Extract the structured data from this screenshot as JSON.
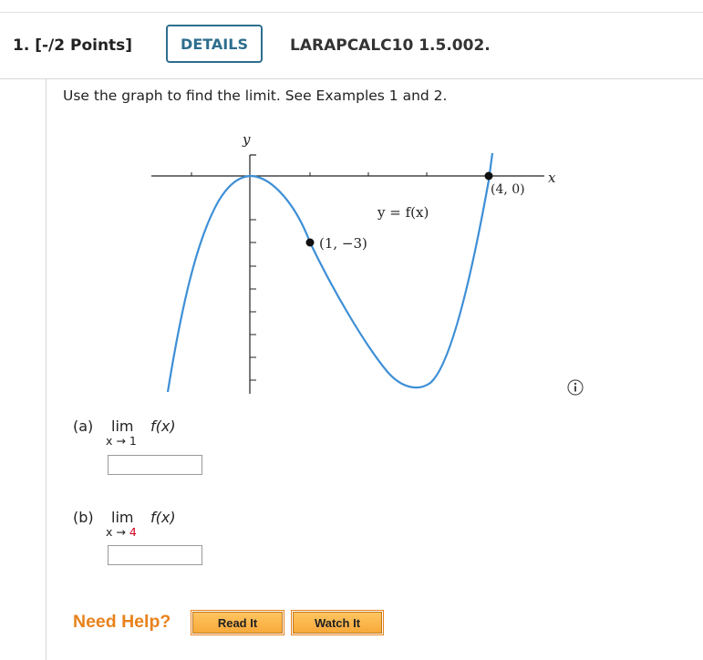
{
  "header": {
    "question_number": "1.  [-/2 Points]",
    "details_label": "DETAILS",
    "question_id": "LARAPCALC10 1.5.002."
  },
  "prompt": "Use the graph to find the limit. See Examples 1 and 2.",
  "graph": {
    "y_axis_label": "y",
    "x_axis_label": "x",
    "curve_label": "y = f(x)",
    "point_a_label": "(1, −3)",
    "point_b_label": "(4, 0)",
    "curve_color": "#3d8fd6"
  },
  "info_icon": "info-icon",
  "parts": [
    {
      "label": "(a)",
      "lim": "lim",
      "fx": "f(x)",
      "sub_prefix": "x → ",
      "sub_value": "1",
      "sub_value_red": false,
      "answer": ""
    },
    {
      "label": "(b)",
      "lim": "lim",
      "fx": "f(x)",
      "sub_prefix": "x → ",
      "sub_value": "4",
      "sub_value_red": true,
      "answer": ""
    }
  ],
  "help": {
    "need_help": "Need Help?",
    "read_it": "Read It",
    "watch_it": "Watch It"
  }
}
